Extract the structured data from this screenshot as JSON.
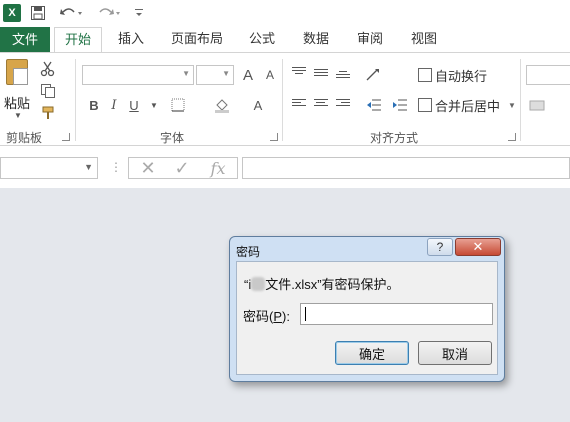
{
  "tabs": {
    "file": "文件",
    "home": "开始",
    "insert": "插入",
    "page_layout": "页面布局",
    "formulas": "公式",
    "data": "数据",
    "review": "审阅",
    "view": "视图"
  },
  "ribbon": {
    "paste_label": "粘贴",
    "clipboard_group": "剪贴板",
    "font_group": "字体",
    "alignment_group": "对齐方式",
    "wrap_text": "自动换行",
    "merge_center": "合并后居中",
    "bold": "B",
    "italic": "I",
    "underline": "U",
    "grow_font": "A",
    "shrink_font": "A",
    "font_color": "A"
  },
  "formula_bar": {
    "dots": "⋮",
    "cancel": "✕",
    "enter": "✓",
    "fx": "fx"
  },
  "dialog": {
    "title": "密码",
    "help": "?",
    "close": "✕",
    "message_prefix": "“i",
    "message_suffix": "文件.xlsx”有密码保护。",
    "password_label_pre": "密码(",
    "password_label_key": "P",
    "password_label_post": "):",
    "password_value": "",
    "ok": "确定",
    "cancel": "取消"
  },
  "colors": {
    "excel_green": "#217346",
    "close_red": "#c64a34",
    "dialog_frame": "#cfe0f3",
    "workspace": "#e4e7ec"
  }
}
